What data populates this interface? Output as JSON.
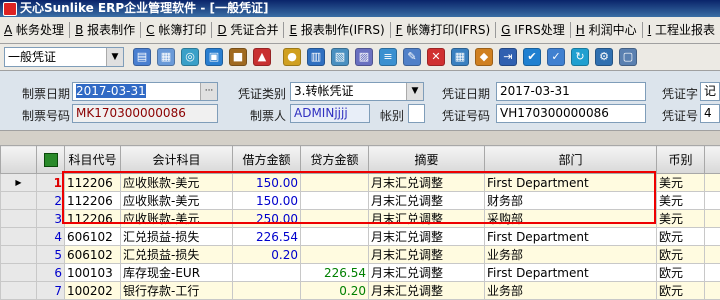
{
  "window": {
    "title": "天心Sunlike ERP企业管理软件 - [一般凭证]"
  },
  "menu": [
    {
      "key": "A",
      "label": "帐务处理"
    },
    {
      "key": "B",
      "label": "报表制作"
    },
    {
      "key": "C",
      "label": "帐簿打印"
    },
    {
      "key": "D",
      "label": "凭证合并"
    },
    {
      "key": "E",
      "label": "报表制作(IFRS)"
    },
    {
      "key": "F",
      "label": "帐簿打印(IFRS)"
    },
    {
      "key": "G",
      "label": "IFRS处理"
    },
    {
      "key": "H",
      "label": "利润中心"
    },
    {
      "key": "I",
      "label": "工程业报表"
    }
  ],
  "toolbar": {
    "voucher_type_select": "一般凭证"
  },
  "form": {
    "issue_date_label": "制票日期",
    "issue_date": "2017-03-31",
    "issue_no_label": "制票号码",
    "issue_no": "MK170300000086",
    "voucher_category_label": "凭证类别",
    "voucher_category": "3.转帐凭证",
    "maker_label": "制票人",
    "maker": "ADMINjjjj",
    "account_type_label": "帐别",
    "account_type": "",
    "voucher_date_label": "凭证日期",
    "voucher_date": "2017-03-31",
    "voucher_no_label": "凭证号码",
    "voucher_no": "VH170300000086",
    "voucher_word_label": "凭证字",
    "voucher_word": "记",
    "voucher_num_label": "凭证号",
    "voucher_num": "4"
  },
  "grid": {
    "headers": [
      "科目代号",
      "会计科目",
      "借方金额",
      "贷方金额",
      "摘要",
      "部门",
      "币别"
    ],
    "rows": [
      {
        "n": "1",
        "code": "112206",
        "account": "应收账款-美元",
        "debit": "150.00",
        "credit": "",
        "summary": "月末汇兑调整",
        "dept": "First Department",
        "currency": "美元"
      },
      {
        "n": "2",
        "code": "112206",
        "account": "应收账款-美元",
        "debit": "150.00",
        "credit": "",
        "summary": "月末汇兑调整",
        "dept": "财务部",
        "currency": "美元"
      },
      {
        "n": "3",
        "code": "112206",
        "account": "应收账款-美元",
        "debit": "250.00",
        "credit": "",
        "summary": "月末汇兑调整",
        "dept": "采购部",
        "currency": "美元"
      },
      {
        "n": "4",
        "code": "606102",
        "account": "汇兑损益-损失",
        "debit": "226.54",
        "credit": "",
        "summary": "月末汇兑调整",
        "dept": "First Department",
        "currency": "欧元"
      },
      {
        "n": "5",
        "code": "606102",
        "account": "汇兑损益-损失",
        "debit": "0.20",
        "credit": "",
        "summary": "月末汇兑调整",
        "dept": "业务部",
        "currency": "欧元"
      },
      {
        "n": "6",
        "code": "100103",
        "account": "库存现金-EUR",
        "debit": "",
        "credit": "226.54",
        "summary": "月末汇兑调整",
        "dept": "First Department",
        "currency": "欧元"
      },
      {
        "n": "7",
        "code": "100202",
        "account": "银行存款-工行",
        "debit": "",
        "credit": "0.20",
        "summary": "月末汇兑调整",
        "dept": "业务部",
        "currency": "欧元"
      }
    ]
  },
  "colors": {
    "highlight_box": "#e00000",
    "debit_text": "#0000cc",
    "credit_text": "#008000"
  }
}
